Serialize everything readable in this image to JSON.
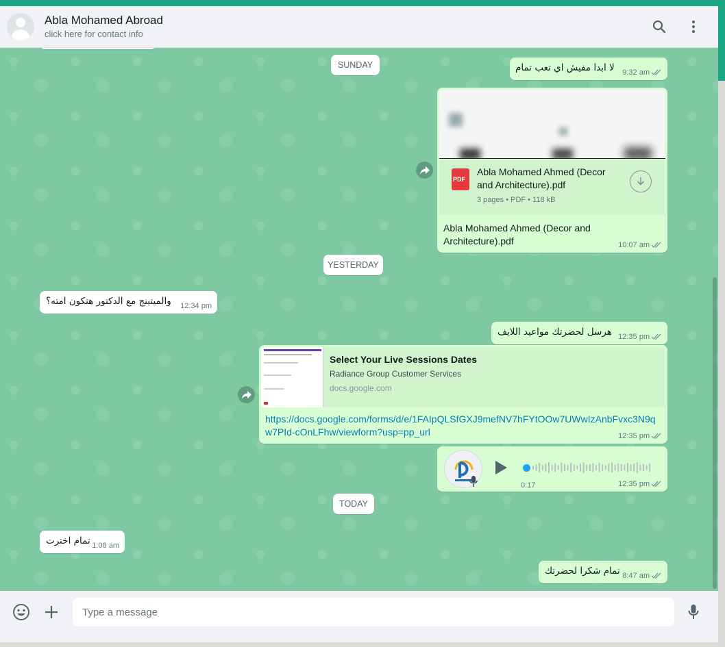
{
  "header": {
    "contact_name": "Abla Mohamed Abroad",
    "contact_subtitle": "click here for contact info"
  },
  "dates": {
    "sunday": "SUNDAY",
    "yesterday": "YESTERDAY",
    "today": "TODAY"
  },
  "messages": {
    "m1": {
      "text": "لا ابدا مفيش اي تعب تمام",
      "time": "9:32 am"
    },
    "m2": {
      "file_name": "Abla Mohamed Ahmed (Decor and Architecture).pdf",
      "file_name_line1": "Abla Mohamed Ahmed (Decor",
      "file_name_line2": "and Architecture).pdf",
      "file_meta": "3 pages • PDF • 118 kB",
      "file_badge": "PDF",
      "caption_line1": "Abla Mohamed Ahmed (Decor and",
      "caption_line2": "Architecture).pdf",
      "time": "10:07 am"
    },
    "m3": {
      "text": "والميتينج مع الدكتور هتكون امته؟",
      "time": "12:34 pm"
    },
    "m4": {
      "text": "هرسل لحضرتك مواعيد اللايف",
      "time": "12:35 pm"
    },
    "m5": {
      "link_title": "Select Your Live Sessions Dates",
      "link_desc": "Radiance Group Customer Services",
      "link_domain": "docs.google.com",
      "url_line1": "https://docs.google.com/forms/d/e/1FAIpQLSfGXJ9mefNV7hFYtOOw7UWwIzAnbFvxc3N9q",
      "url_line2": "w7PId-cOnLFhw/viewform?usp=pp_url",
      "time": "12:35 pm"
    },
    "m6": {
      "duration": "0:17",
      "time": "12:35 pm",
      "progress": 0.0
    },
    "m7": {
      "text": "تمام اخترت",
      "time": "1:08 am"
    },
    "m8": {
      "text": "تمام شكرا لحضرتك",
      "time": "8:47 am"
    }
  },
  "footer": {
    "placeholder": "Type a message"
  },
  "icons": {
    "search": "search-icon",
    "menu": "kebab-menu-icon",
    "emoji": "emoji-icon",
    "attach": "plus-icon",
    "mic": "microphone-icon",
    "forward": "forward-icon",
    "download": "download-icon",
    "play": "play-icon"
  },
  "colors": {
    "chat_bg": "#7ec9a2",
    "outgoing": "#d9fdd3",
    "incoming": "#ffffff",
    "link": "#027eb5",
    "accent": "#1aa784"
  }
}
